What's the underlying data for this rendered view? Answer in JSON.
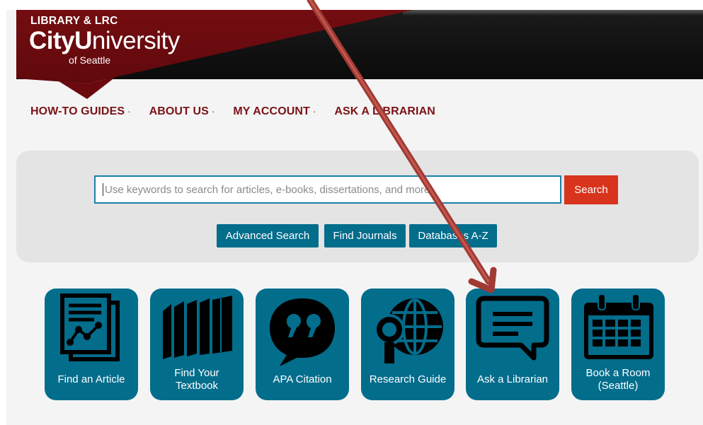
{
  "header": {
    "library_label": "LIBRARY & LRC",
    "logo_city": "City",
    "logo_u": "U",
    "logo_niversity": "niversity",
    "logo_sub": "of Seattle"
  },
  "nav": {
    "items": [
      {
        "label": "HOW-TO GUIDES",
        "dropdown": true
      },
      {
        "label": "ABOUT US",
        "dropdown": true
      },
      {
        "label": "MY ACCOUNT",
        "dropdown": true
      },
      {
        "label": "ASK A LIBRARIAN",
        "dropdown": false
      }
    ],
    "dropdown_marker": "·"
  },
  "search": {
    "placeholder": "Use keywords to search for articles, e-books, dissertations, and more",
    "button_label": "Search",
    "links": [
      "Advanced Search",
      "Find Journals",
      "Databases A-Z"
    ]
  },
  "tiles": [
    {
      "label": "Find an Article",
      "icon": "article-chart-icon"
    },
    {
      "label": "Find Your Textbook",
      "icon": "books-icon"
    },
    {
      "label": "APA Citation",
      "icon": "quote-bubble-icon"
    },
    {
      "label": "Research Guide",
      "icon": "globe-magnifier-icon"
    },
    {
      "label": "Ask a Librarian",
      "icon": "chat-bubble-icon"
    },
    {
      "label": "Book a Room (Seattle)",
      "icon": "calendar-icon"
    }
  ],
  "colors": {
    "brand_red": "#6b0a0e",
    "nav_red": "#7a1318",
    "teal": "#036d8c",
    "search_red": "#d8341d",
    "arrow": "#a03a34"
  }
}
